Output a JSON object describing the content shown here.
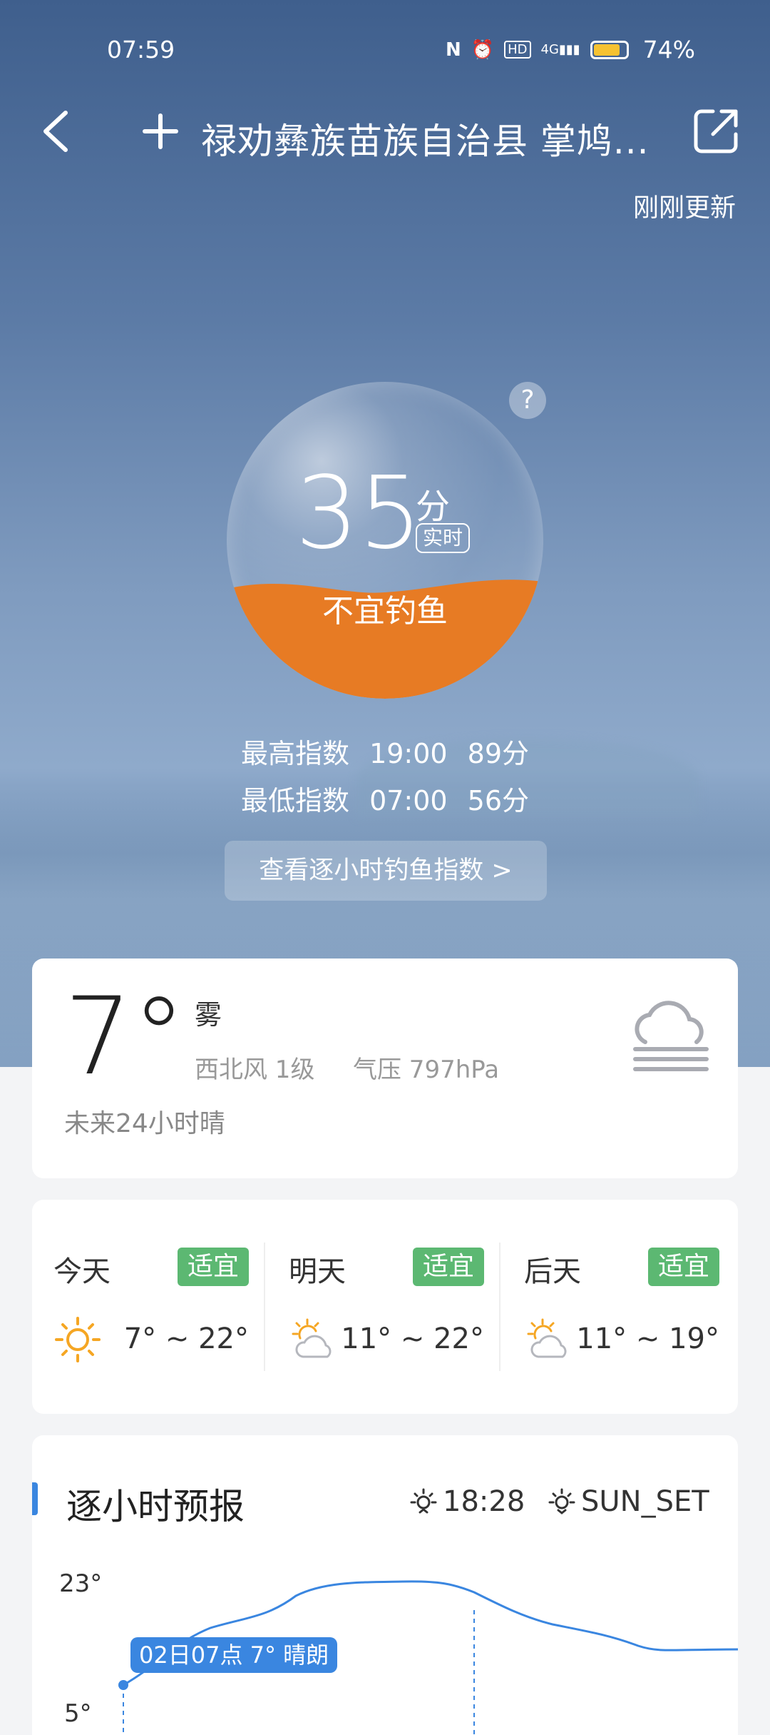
{
  "status_bar": {
    "time": "07:59",
    "network": "4G",
    "battery_pct": "74%",
    "battery_level": 0.74
  },
  "header": {
    "location": "禄劝彝族苗族自治县 掌鸠...",
    "updated": "刚刚更新"
  },
  "fishing": {
    "score": "35",
    "unit": "分",
    "realtime": "实时",
    "verdict": "不宜钓鱼",
    "fill_level": 0.35,
    "high": {
      "label": "最高指数",
      "time": "19:00",
      "score": "89分"
    },
    "low": {
      "label": "最低指数",
      "time": "07:00",
      "score": "56分"
    },
    "hourly_button": "查看逐小时钓鱼指数 >",
    "help": "?"
  },
  "current": {
    "temp": "7°",
    "condition": "雾",
    "wind": "西北风  1级",
    "pressure": "气压  797hPa",
    "future": "未来24小时晴",
    "icon": "fog-icon"
  },
  "days": [
    {
      "name": "今天",
      "badge": "适宜",
      "range": "7° ~ 22°",
      "icon": "sun-icon"
    },
    {
      "name": "明天",
      "badge": "适宜",
      "range": "11° ~ 22°",
      "icon": "partly-cloudy-icon"
    },
    {
      "name": "后天",
      "badge": "适宜",
      "range": "11° ~ 19°",
      "icon": "partly-cloudy-icon"
    }
  ],
  "hourly": {
    "title": "逐小时预报",
    "sunrise": "18:28",
    "sunset": "SUN_SET",
    "y_max": "23°",
    "y_min": "5°",
    "tooltip": "02日07点 7° 晴朗"
  },
  "colors": {
    "accent": "#3a86e0",
    "badge": "#5cb872",
    "orb_fill": "#e77b24",
    "sun": "#f5a623"
  }
}
